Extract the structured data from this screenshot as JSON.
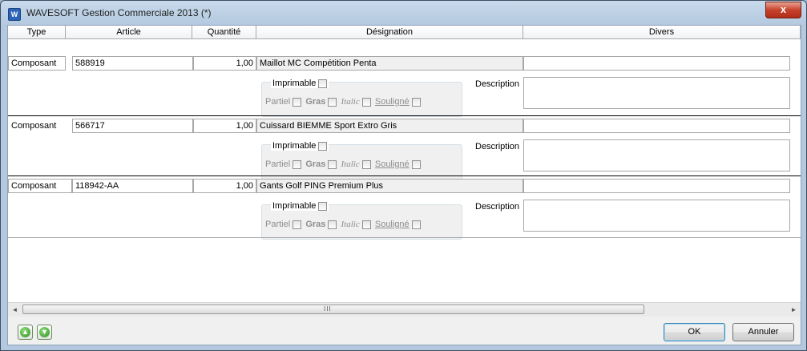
{
  "window": {
    "title": "WAVESOFT Gestion Commerciale 2013 (*)",
    "close_label": "x"
  },
  "columns": [
    "Type",
    "Article",
    "Quantité",
    "Désignation",
    "Divers"
  ],
  "rows": [
    {
      "type": "Composant",
      "article": "588919",
      "quantite": "1,00",
      "designation": "Maillot MC Compétition Penta",
      "divers": "",
      "imprimable": "Imprimable",
      "partiel": "Partiel",
      "gras": "Gras",
      "italic": "Italic",
      "souligne": "Souligné",
      "description_label": "Description",
      "description": ""
    },
    {
      "type": "Composant",
      "article": "566717",
      "quantite": "1,00",
      "designation": "Cuissard BIEMME Sport Extro Gris",
      "divers": "",
      "imprimable": "Imprimable",
      "partiel": "Partiel",
      "gras": "Gras",
      "italic": "Italic",
      "souligne": "Souligné",
      "description_label": "Description",
      "description": ""
    },
    {
      "type": "Composant",
      "article": "118942-AA",
      "quantite": "1,00",
      "designation": "Gants Golf PING Premium Plus",
      "divers": "",
      "imprimable": "Imprimable",
      "partiel": "Partiel",
      "gras": "Gras",
      "italic": "Italic",
      "souligne": "Souligné",
      "description_label": "Description",
      "description": ""
    }
  ],
  "scrollbar": {
    "grip": "III",
    "left_arrow": "◄",
    "right_arrow": "►"
  },
  "footer": {
    "up_icon": "up-arrow-icon",
    "down_icon": "down-arrow-icon",
    "ok_label": "OK",
    "cancel_label": "Annuler"
  }
}
